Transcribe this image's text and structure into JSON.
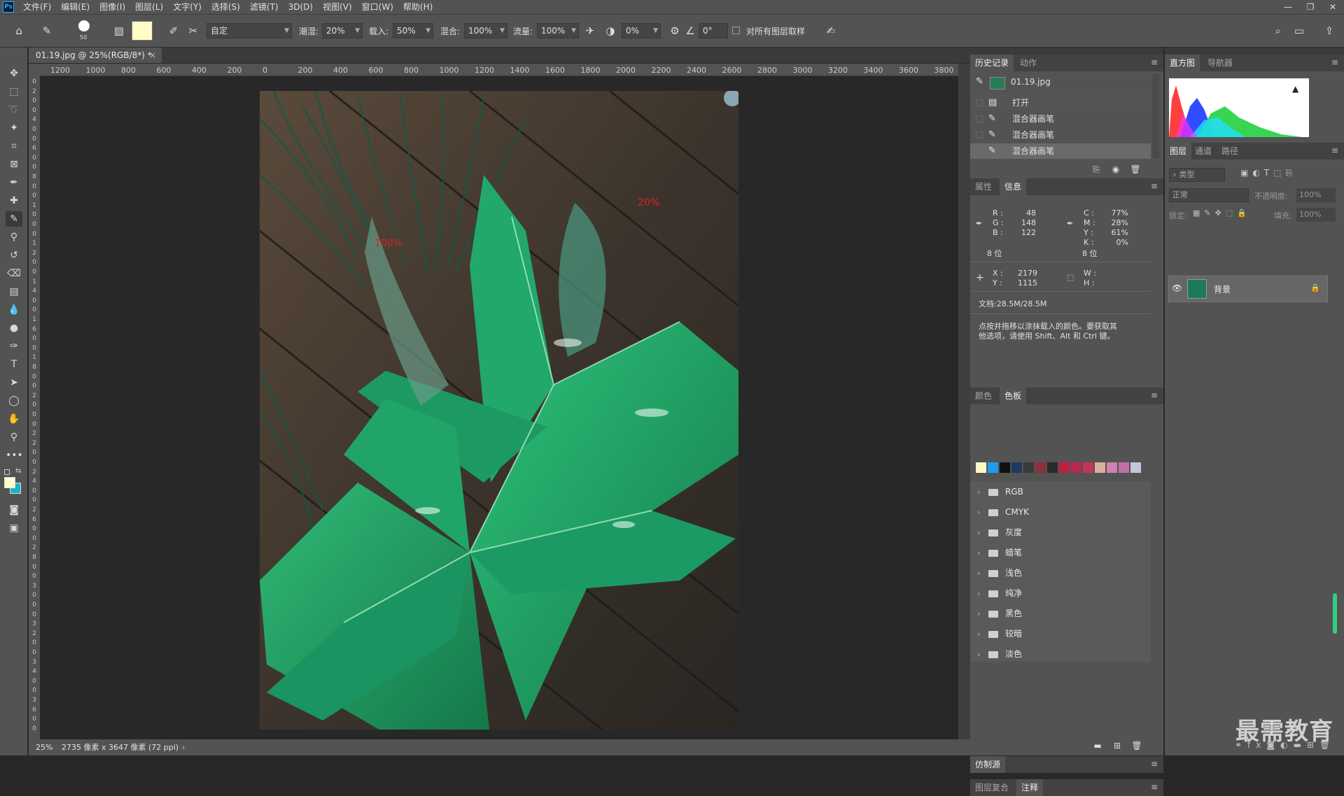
{
  "app": {
    "logo": "Ps"
  },
  "menu": [
    "文件(F)",
    "编辑(E)",
    "图像(I)",
    "图层(L)",
    "文字(Y)",
    "选择(S)",
    "滤镜(T)",
    "3D(D)",
    "视图(V)",
    "窗口(W)",
    "帮助(H)"
  ],
  "options": {
    "brush_size": "50",
    "preset": "自定",
    "wet_label": "潮湿:",
    "wet_value": "20%",
    "load_label": "载入:",
    "load_value": "50%",
    "mix_label": "混合:",
    "mix_value": "100%",
    "flow_label": "流量:",
    "flow_value": "100%",
    "smooth_value": "0%",
    "angle_value": "0°",
    "sample_all_label": "对所有图层取样",
    "foreground_color": "#fffcc8"
  },
  "document": {
    "tab_title": "01.19.jpg @ 25%(RGB/8*) *",
    "zoom": "25%",
    "size_info": "2735 像素 x 3647 像素 (72 ppi)",
    "annotation_1": "100%",
    "annotation_2": "20%"
  },
  "ruler_h": [
    "1200",
    "1000",
    "800",
    "600",
    "400",
    "200",
    "0",
    "200",
    "400",
    "600",
    "800",
    "1000",
    "1200",
    "1400",
    "1600",
    "1800",
    "2000",
    "2200",
    "2400",
    "2600",
    "2800",
    "3000",
    "3200",
    "3400",
    "3600",
    "3800"
  ],
  "ruler_v": [
    "0",
    "2",
    "0",
    "0",
    "4",
    "0",
    "0",
    "6",
    "0",
    "0",
    "8",
    "0",
    "0",
    "1",
    "0",
    "0",
    "0",
    "1",
    "2",
    "0",
    "0",
    "1",
    "4",
    "0",
    "0",
    "1",
    "6",
    "0",
    "0",
    "1",
    "8",
    "0",
    "0",
    "2",
    "0",
    "0",
    "0",
    "2",
    "2",
    "0",
    "0",
    "2",
    "4",
    "0",
    "0",
    "2",
    "6",
    "0",
    "0",
    "2",
    "8",
    "0",
    "0",
    "3",
    "0",
    "0",
    "0",
    "3",
    "2",
    "0",
    "0",
    "3",
    "4",
    "0",
    "0",
    "3",
    "6",
    "0",
    "0"
  ],
  "history": {
    "tabs": [
      "历史记录",
      "动作"
    ],
    "snapshot": "01.19.jpg",
    "items": [
      "打开",
      "混合器画笔",
      "混合器画笔",
      "混合器画笔"
    ]
  },
  "info": {
    "tabs": [
      "属性",
      "信息"
    ],
    "rgb": {
      "R": "48",
      "G": "148",
      "B": "122"
    },
    "cmyk": {
      "C": "77%",
      "M": "28%",
      "Y": "61%",
      "K": "0%"
    },
    "bits_left": "8 位",
    "bits_right": "8 位",
    "xy": {
      "X": "2179",
      "Y": "1115"
    },
    "wh": {
      "W": "",
      "H": ""
    },
    "doc": "文档:28.5M/28.5M",
    "tip_line1": "点按并拖移以涂抹载入的颜色。要获取其",
    "tip_line2": "他选项，请使用 Shift、Alt 和 Ctrl 键。"
  },
  "swatches": {
    "tabs": [
      "颜色",
      "色板"
    ],
    "colors": [
      "#fff8c4",
      "#1e9cf0",
      "#101010",
      "#1f3a5c",
      "#3a3a3a",
      "#8c3040",
      "#2a2a2a",
      "#c02040",
      "#b82850",
      "#c03858",
      "#d8b0a0",
      "#d080b0",
      "#c070a8",
      "#c0c8d8"
    ],
    "groups": [
      "RGB",
      "CMYK",
      "灰度",
      "蜡笔",
      "浅色",
      "纯净",
      "黑色",
      "较暗",
      "淡色"
    ]
  },
  "clone_source": {
    "tabs": [
      "仿制源"
    ]
  },
  "bottom_tabs": [
    "图层复合",
    "注释"
  ],
  "histogram": {
    "tabs": [
      "直方图",
      "导航器"
    ]
  },
  "layers": {
    "tabs": [
      "图层",
      "通道",
      "路径"
    ],
    "search_placeholder": "类型",
    "blend_mode": "正常",
    "opacity_label": "不透明度:",
    "opacity_value": "100%",
    "lock_label": "锁定:",
    "fill_label": "填充:",
    "fill_value": "100%",
    "layer_name": "背景"
  },
  "watermark": "最需教育"
}
